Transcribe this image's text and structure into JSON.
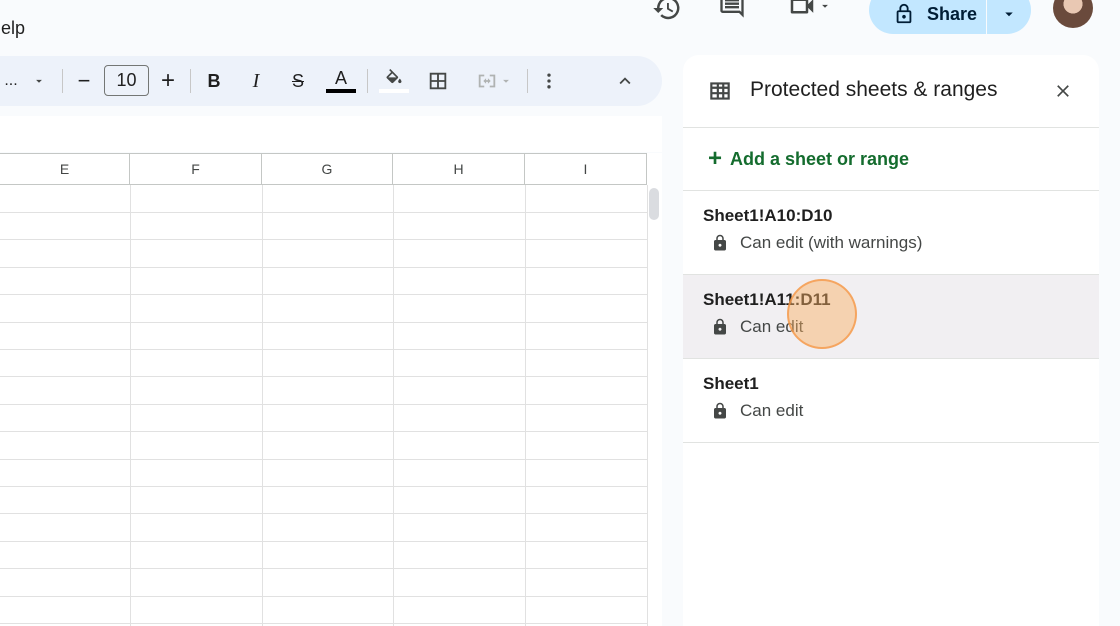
{
  "menu": {
    "help_label": "Help"
  },
  "header": {
    "history_icon": "history-icon",
    "comments_icon": "comment-icon",
    "meet_icon": "video-icon",
    "share_label": "Share",
    "share_color": "#c2e7ff"
  },
  "toolbar": {
    "font_ellipsis": "...",
    "font_size": "10",
    "minus": "−",
    "plus": "+",
    "bold": "B",
    "italic": "I",
    "strike": "S",
    "textcolor": "A"
  },
  "grid": {
    "columns": [
      "E",
      "F",
      "G",
      "H",
      "I"
    ]
  },
  "panel": {
    "title": "Protected sheets & ranges",
    "add_label": "Add a sheet or range",
    "add_color": "#146c2e",
    "items": [
      {
        "range": "Sheet1!A10:D10",
        "permission": "Can edit (with warnings)"
      },
      {
        "range": "Sheet1!A11:D11",
        "permission": "Can edit"
      },
      {
        "range": "Sheet1",
        "permission": "Can edit"
      }
    ]
  }
}
